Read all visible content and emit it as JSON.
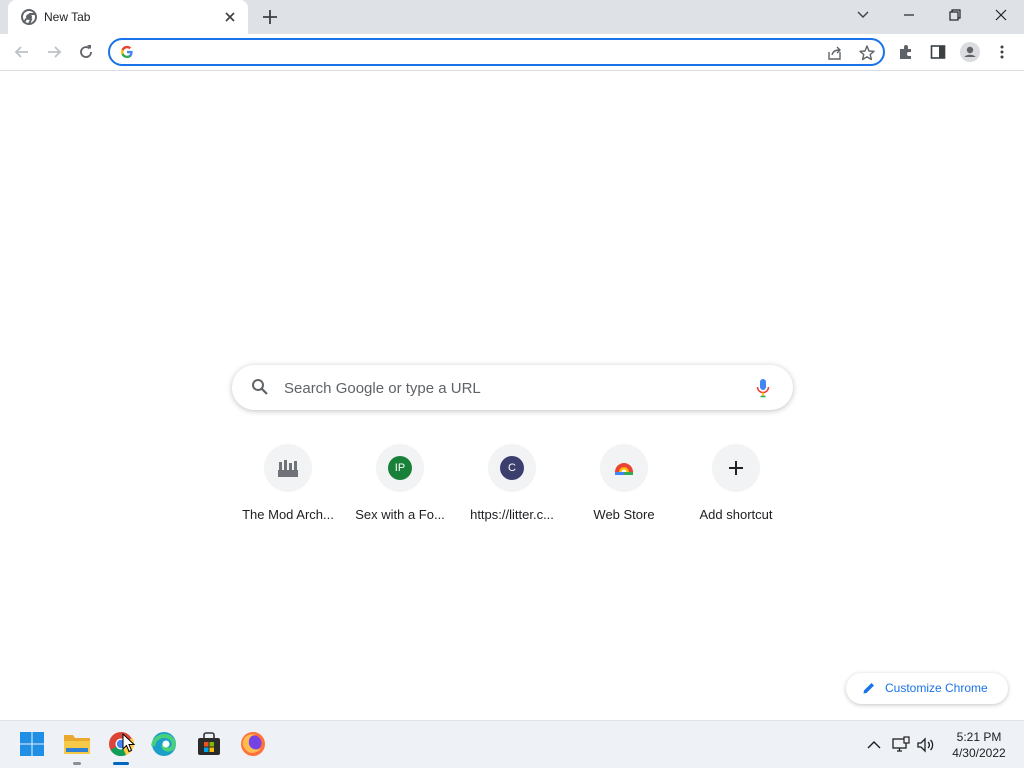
{
  "browser": {
    "tab": {
      "title": "New Tab"
    },
    "omnibox": {
      "value": "",
      "placeholder": ""
    }
  },
  "ntp": {
    "search": {
      "placeholder": "Search Google or type a URL"
    },
    "shortcuts": [
      {
        "label": "The Mod Arch...",
        "icon": "mod-archive-favicon"
      },
      {
        "label": "Sex with a Fo...",
        "icon": "letter-avatar",
        "letter": "IP",
        "color": "#188038"
      },
      {
        "label": "https://litter.c...",
        "icon": "letter-avatar",
        "letter": "C",
        "color": "#3c3f6e"
      },
      {
        "label": "Web Store",
        "icon": "chrome-web-store-icon"
      },
      {
        "label": "Add shortcut",
        "icon": "plus-icon"
      }
    ],
    "customize": {
      "label": "Customize Chrome"
    }
  },
  "taskbar": {
    "apps": [
      "start",
      "file-explorer",
      "chrome",
      "edge",
      "microsoft-store",
      "firefox"
    ],
    "active_app": "chrome",
    "clock": {
      "time": "5:21 PM",
      "date": "4/30/2022"
    }
  },
  "colors": {
    "accent": "#1a73e8",
    "tabstrip": "#dee1e6",
    "taskbar": "#eef1f6"
  }
}
